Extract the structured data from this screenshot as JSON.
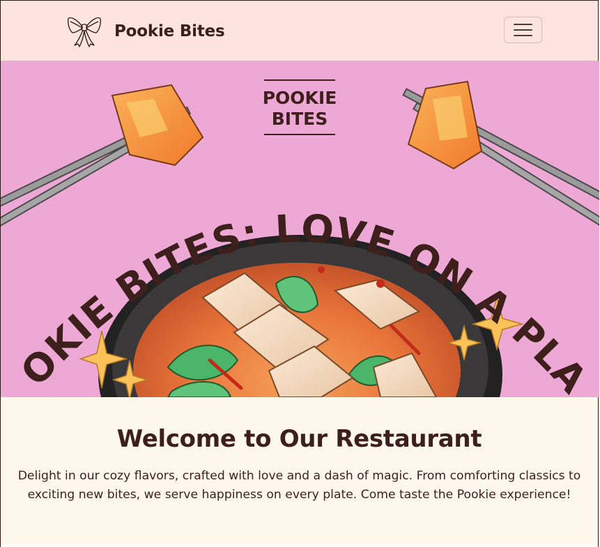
{
  "navbar": {
    "brand_name": "Pookie Bites",
    "logo_icon": "bow-icon",
    "toggler_icon": "hamburger-menu-icon"
  },
  "hero": {
    "badge_line1": "POOKIE",
    "badge_line2": "BITES",
    "arc_title": "POOKIE BITES: LOVE ON A PLATE",
    "background_color": "#eea8d5"
  },
  "welcome": {
    "heading": "Welcome to Our Restaurant",
    "text": "Delight in our cozy flavors, crafted with love and a dash of magic. From comforting classics to exciting new bites, we serve happiness on every plate. Come taste the Pookie experience!"
  },
  "colors": {
    "navbar_bg": "#fde4df",
    "content_bg": "#fdf7ec",
    "text_dark": "#3d1f1c"
  }
}
